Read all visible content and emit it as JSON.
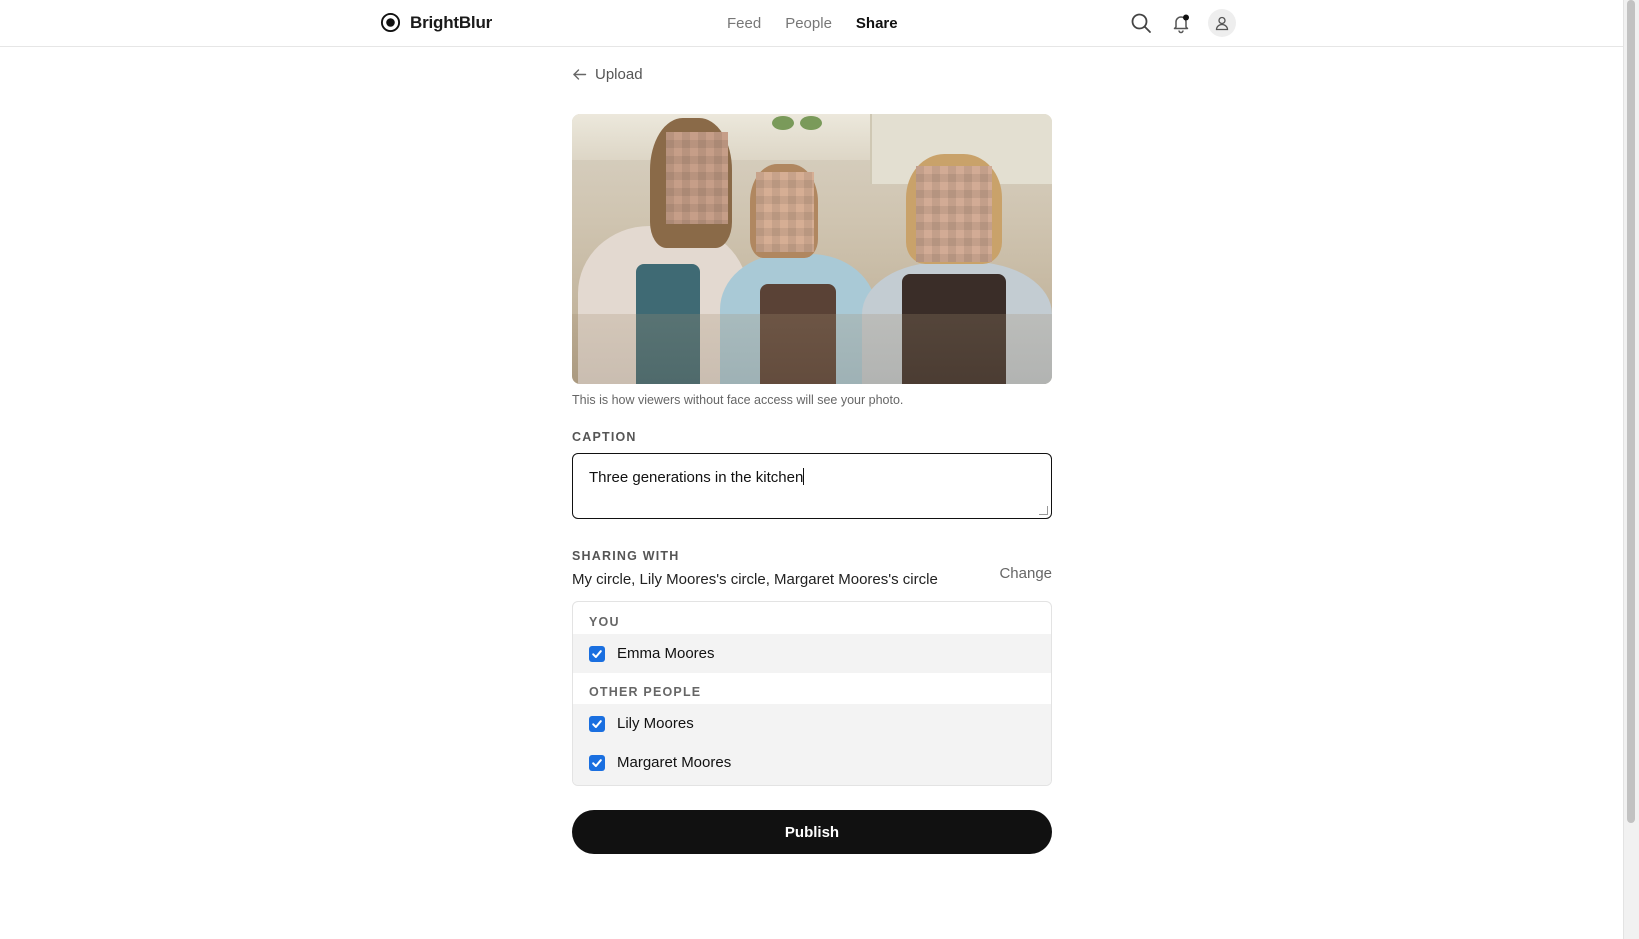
{
  "app": {
    "name": "BrightBlur",
    "logo_icon": "brightblur-logo-icon"
  },
  "nav": {
    "items": [
      {
        "label": "Feed",
        "active": false
      },
      {
        "label": "People",
        "active": false
      },
      {
        "label": "Share",
        "active": true
      }
    ]
  },
  "header_icons": [
    "search-icon",
    "notification-bell-icon",
    "user-account-icon"
  ],
  "back": {
    "label": "Upload",
    "icon": "arrow-left-icon"
  },
  "photo": {
    "note": "This is how viewers without face access will see your photo."
  },
  "caption": {
    "label": "CAPTION",
    "value": "Three generations in the kitchen"
  },
  "sharing": {
    "label": "SHARING WITH",
    "value": "My circle, Lily Moores's circle, Margaret Moores's circle",
    "change_label": "Change"
  },
  "people": {
    "you_label": "YOU",
    "you": [
      {
        "name": "Emma Moores",
        "checked": true
      }
    ],
    "other_label": "OTHER PEOPLE",
    "others": [
      {
        "name": "Lily Moores",
        "checked": true
      },
      {
        "name": "Margaret Moores",
        "checked": true
      }
    ]
  },
  "publish_label": "Publish",
  "colors": {
    "checkbox": "#1a6fe0",
    "primary_button": "#111111"
  }
}
